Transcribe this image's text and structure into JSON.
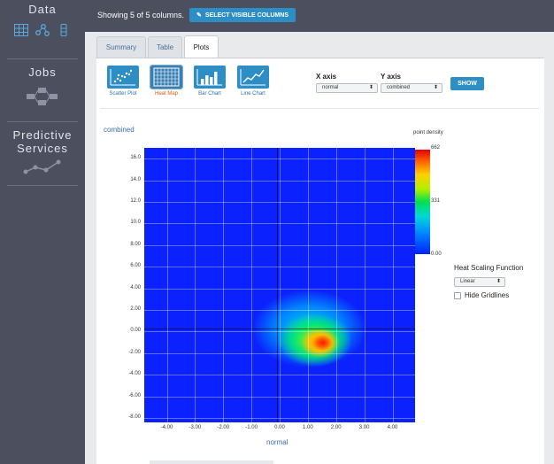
{
  "sidebar": {
    "data_label": "Data",
    "jobs_label": "Jobs",
    "predictive_label_line1": "Predictive",
    "predictive_label_line2": "Services"
  },
  "toolbar": {
    "columns_text": "Showing 5 of 5 columns.",
    "select_columns_label": "SELECT VISIBLE COLUMNS"
  },
  "tabs": [
    {
      "label": "Summary"
    },
    {
      "label": "Table"
    },
    {
      "label": "Plots"
    }
  ],
  "plot_types": [
    {
      "label": "Scatter Plot",
      "icon": "scatter-plot-icon"
    },
    {
      "label": "Heat Map",
      "icon": "heat-map-icon"
    },
    {
      "label": "Bar Chart",
      "icon": "bar-chart-icon"
    },
    {
      "label": "Line Chart",
      "icon": "line-chart-icon"
    }
  ],
  "axes": {
    "x_label": "X axis",
    "x_value": "normal",
    "y_label": "Y axis",
    "y_value": "combined",
    "show_button": "SHOW"
  },
  "chart_data": {
    "type": "heatmap",
    "xlabel": "normal",
    "ylabel": "combined",
    "xlim": [
      -4.8,
      4.8
    ],
    "ylim": [
      -8.4,
      17.0
    ],
    "x_ticks": [
      "-4.00",
      "-3.00",
      "-2.00",
      "-1.00",
      "0.00",
      "1.00",
      "2.00",
      "3.00",
      "4.00"
    ],
    "y_ticks": [
      "16.0",
      "14.0",
      "12.0",
      "10.0",
      "8.00",
      "6.00",
      "4.00",
      "2.00",
      "0.00",
      "-2.00",
      "-4.00",
      "-6.00",
      "-8.00"
    ],
    "legend_title": "point density",
    "color_scale_max": "662",
    "color_scale_mid": "331",
    "color_scale_min": "0.00",
    "grid": true
  },
  "controls": {
    "heat_scaling_label": "Heat Scaling Function",
    "heat_scaling_value": "Linear",
    "hide_gridlines_label": "Hide Gridlines",
    "hide_gridlines_checked": false
  },
  "colors": {
    "sidebar_bg": "#4b4f5e",
    "accent": "#2d8ec6",
    "selected_plot_label": "#e05a00"
  }
}
